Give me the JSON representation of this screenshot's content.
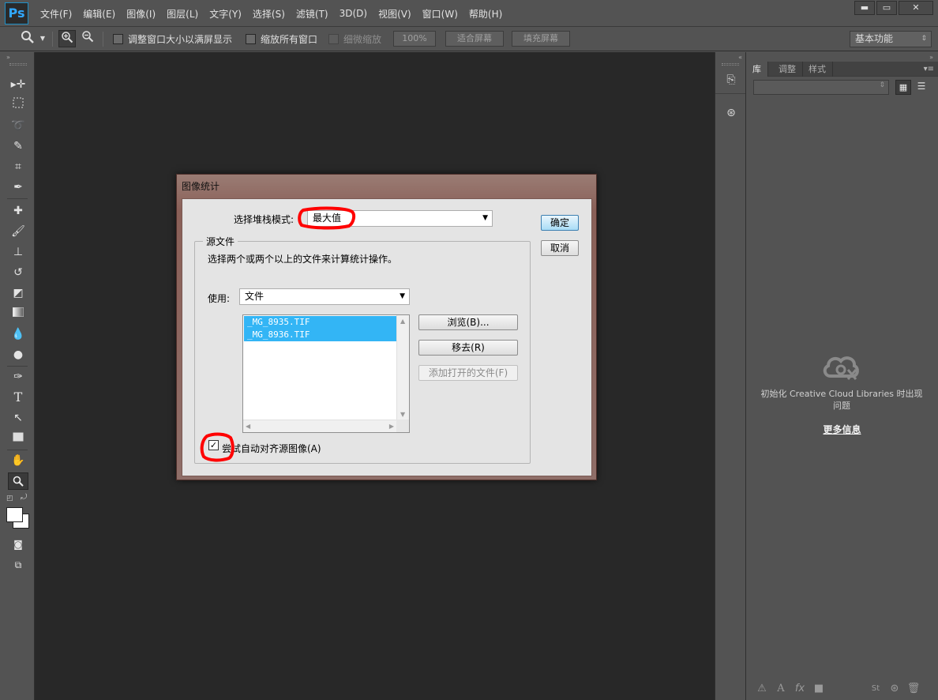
{
  "app": {
    "logo": "Ps"
  },
  "menu": [
    "文件(F)",
    "编辑(E)",
    "图像(I)",
    "图层(L)",
    "文字(Y)",
    "选择(S)",
    "滤镜(T)",
    "3D(D)",
    "视图(V)",
    "窗口(W)",
    "帮助(H)"
  ],
  "window_controls": {
    "minimize": "▬",
    "restore": "▭",
    "close": "✕"
  },
  "options_bar": {
    "tool_icon": "zoom-icon",
    "checkbox_resize": "调整窗口大小以满屏显示",
    "checkbox_all_windows": "缩放所有窗口",
    "checkbox_scrubby": "细微缩放",
    "btn_100": "100%",
    "btn_fit": "适合屏幕",
    "btn_fill": "填充屏幕",
    "workspace": "基本功能"
  },
  "right_panel": {
    "tabs": [
      "库",
      "调整",
      "样式"
    ],
    "empty_message": "初始化 Creative Cloud Libraries 时出现问题",
    "more_info": "更多信息"
  },
  "dialog": {
    "title": "图像统计",
    "stack_mode_label": "选择堆栈模式:",
    "stack_mode_value": "最大值",
    "ok": "确定",
    "cancel": "取消",
    "group_title": "源文件",
    "instructions": "选择两个或两个以上的文件来计算统计操作。",
    "use_label": "使用:",
    "use_value": "文件",
    "files": [
      "_MG_8935.TIF",
      "_MG_8936.TIF"
    ],
    "browse": "浏览(B)...",
    "remove": "移去(R)",
    "add_open": "添加打开的文件(F)",
    "align_checkbox": "尝试自动对齐源图像(A)",
    "align_checked": true
  },
  "colors": {
    "annotation_red": "#ff0000",
    "selection_blue": "#33b5f5",
    "ps_blue": "#31a8ff"
  }
}
